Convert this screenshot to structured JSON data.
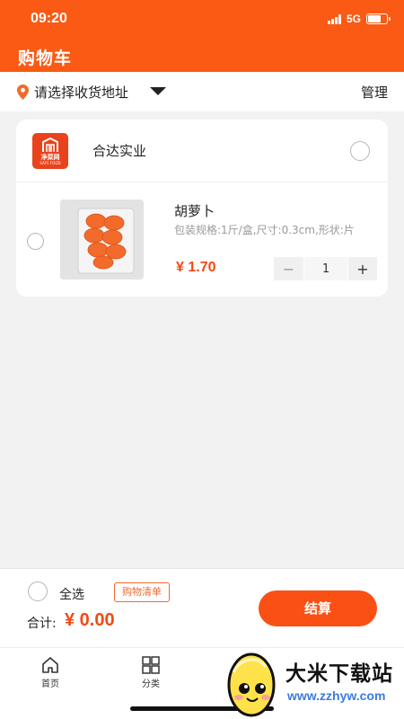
{
  "status_bar": {
    "time": "09:20",
    "network": "5G",
    "battery_level": 0.7
  },
  "header": {
    "title": "购物车"
  },
  "address": {
    "text": "请选择收货地址",
    "manage": "管理"
  },
  "shop": {
    "name": "合达实业",
    "logo_text": "净菜网",
    "logo_subtext": "SAFE FOOD",
    "item": {
      "name": "胡萝卜",
      "spec": "包装规格:1斤/盒,尺寸:0.3cm,形状:片",
      "price": "¥ 1.70",
      "quantity": "1",
      "minus": "−",
      "plus": "+"
    }
  },
  "footer": {
    "select_all": "全选",
    "shopping_list": "购物清单",
    "total_label": "合计:",
    "total_value": "¥ 0.00",
    "checkout": "结算"
  },
  "tabbar": {
    "tabs": [
      {
        "label": "首页"
      },
      {
        "label": "分类"
      }
    ]
  },
  "watermark": {
    "text": "大米下载站",
    "url": "www.zzhyw.com"
  },
  "colors": {
    "accent": "#fa5a14",
    "price": "#f24a12"
  }
}
